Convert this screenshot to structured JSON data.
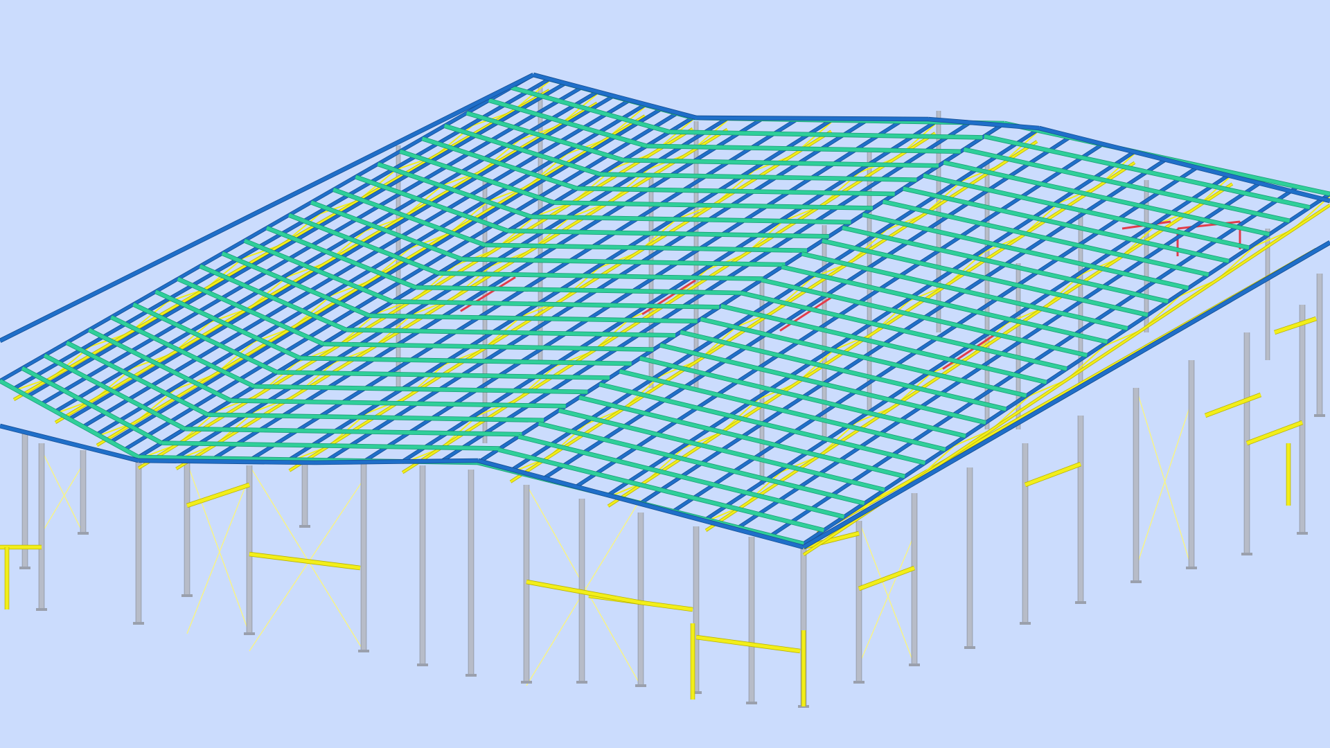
{
  "viewport": {
    "background": "#cbdcfd"
  },
  "model": {
    "kind": "steel-frame-building",
    "view": "isometric",
    "wings": 3,
    "colors": {
      "column": "#b7bcc8",
      "column_shade": "#8e93a0",
      "rafter": "#1f6fc9",
      "rafter_edge": "#174f94",
      "purlin": "#2fcf9a",
      "purlin_edge": "#1a9d75",
      "brace": "#f2ee1a",
      "brace_edge": "#b9b400",
      "rod": "#f6f38a",
      "tie": "#e23c4a",
      "base_plate": "#9aa0ad"
    },
    "components": [
      {
        "name": "steel-columns",
        "color_key": "column"
      },
      {
        "name": "roof-rafters",
        "color_key": "rafter"
      },
      {
        "name": "roof-purlins",
        "color_key": "purlin"
      },
      {
        "name": "wall-girts-and-bracing",
        "color_key": "brace"
      },
      {
        "name": "cross-bracing-rods",
        "color_key": "rod"
      },
      {
        "name": "tie-members",
        "color_key": "tie"
      },
      {
        "name": "base-plates",
        "color_key": "base_plate"
      }
    ]
  }
}
